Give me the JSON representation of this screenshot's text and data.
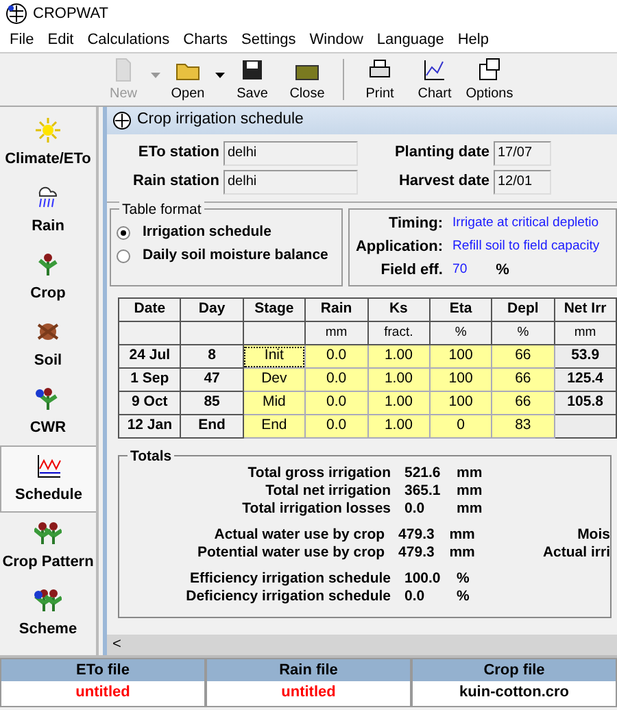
{
  "window": {
    "title": "CROPWAT"
  },
  "menu": [
    "File",
    "Edit",
    "Calculations",
    "Charts",
    "Settings",
    "Window",
    "Language",
    "Help"
  ],
  "toolbar": [
    {
      "label": "New",
      "kind": "new",
      "disabled": true,
      "dropdown": true
    },
    {
      "label": "Open",
      "kind": "open",
      "disabled": false,
      "dropdown": true
    },
    {
      "label": "Save",
      "kind": "save",
      "disabled": false,
      "dropdown": false
    },
    {
      "label": "Close",
      "kind": "close",
      "disabled": false,
      "dropdown": false
    },
    {
      "label": "Print",
      "kind": "print",
      "disabled": false,
      "dropdown": false
    },
    {
      "label": "Chart",
      "kind": "chart",
      "disabled": false,
      "dropdown": false
    },
    {
      "label": "Options",
      "kind": "options",
      "disabled": false,
      "dropdown": false
    }
  ],
  "sidebar": {
    "items": [
      {
        "label": "Climate/ETo",
        "kind": "sun",
        "selected": false
      },
      {
        "label": "Rain",
        "kind": "rain",
        "selected": false
      },
      {
        "label": "Crop",
        "kind": "crop",
        "selected": false
      },
      {
        "label": "Soil",
        "kind": "soil",
        "selected": false
      },
      {
        "label": "CWR",
        "kind": "cwr",
        "selected": false
      },
      {
        "label": "Schedule",
        "kind": "schedule",
        "selected": true
      },
      {
        "label": "Crop Pattern",
        "kind": "pattern",
        "selected": false
      },
      {
        "label": "Scheme",
        "kind": "scheme",
        "selected": false
      }
    ]
  },
  "child_window": {
    "title": "Crop irrigation schedule",
    "fields": [
      {
        "label": "ETo station",
        "value": "delhi"
      },
      {
        "label": "Rain station",
        "value": "delhi"
      }
    ],
    "dates": [
      {
        "label": "Planting date",
        "value": "17/07"
      },
      {
        "label": "Harvest date",
        "value": "12/01"
      }
    ],
    "table_format": {
      "title": "Table format",
      "options": [
        {
          "label": "Irrigation schedule",
          "selected": true
        },
        {
          "label": "Daily soil moisture balance",
          "selected": false
        }
      ]
    },
    "settings": [
      {
        "label": "Timing:",
        "value": "Irrigate at critical depletio"
      },
      {
        "label": "Application:",
        "value": "Refill soil to field capacity"
      },
      {
        "label": "Field eff.",
        "value": "70",
        "unit": "%"
      }
    ],
    "table": {
      "columns": [
        {
          "name": "Date"
        },
        {
          "name": "Day"
        },
        {
          "name": "Stage"
        },
        {
          "name": "Rain",
          "unit": "mm"
        },
        {
          "name": "Ks",
          "unit": "fract."
        },
        {
          "name": "Eta",
          "unit": "%"
        },
        {
          "name": "Depl",
          "unit": "%"
        },
        {
          "name": "Net Irr",
          "unit": "mm"
        }
      ],
      "rows": [
        {
          "cells": [
            "24 Jul",
            "8",
            "Init",
            "0.0",
            "1.00",
            "100",
            "66",
            "53.9"
          ],
          "focused": true
        },
        {
          "cells": [
            "1 Sep",
            "47",
            "Dev",
            "0.0",
            "1.00",
            "100",
            "66",
            "125.4"
          ],
          "focused": false
        },
        {
          "cells": [
            "9 Oct",
            "85",
            "Mid",
            "0.0",
            "1.00",
            "100",
            "66",
            "105.8"
          ],
          "focused": false
        },
        {
          "cells": [
            "12 Jan",
            "End",
            "End",
            "0.0",
            "1.00",
            "0",
            "83",
            ""
          ],
          "focused": false
        }
      ]
    },
    "totals": {
      "title": "Totals",
      "groups": [
        [
          {
            "label": "Total gross irrigation",
            "value": "521.6",
            "unit": "mm"
          },
          {
            "label": "Total net irrigation",
            "value": "365.1",
            "unit": "mm"
          },
          {
            "label": "Total irrigation losses",
            "value": "0.0",
            "unit": "mm"
          }
        ],
        [
          {
            "label": "Actual water use by crop",
            "value": "479.3",
            "unit": "mm",
            "right": "Mois"
          },
          {
            "label": "Potential water use by crop",
            "value": "479.3",
            "unit": "mm",
            "right": "Actual irri"
          }
        ],
        [
          {
            "label": "Efficiency irrigation schedule",
            "value": "100.0",
            "unit": "%"
          },
          {
            "label": "Deficiency irrigation schedule",
            "value": "0.0",
            "unit": "%"
          }
        ]
      ]
    },
    "scrollbar_arrow": "<"
  },
  "status_bar": [
    {
      "label": "ETo file",
      "value": "untitled",
      "color": "#ff0000"
    },
    {
      "label": "Rain file",
      "value": "untitled",
      "color": "#ff0000"
    },
    {
      "label": "Crop file",
      "value": "kuin-cotton.cro",
      "color": "#000000"
    }
  ]
}
